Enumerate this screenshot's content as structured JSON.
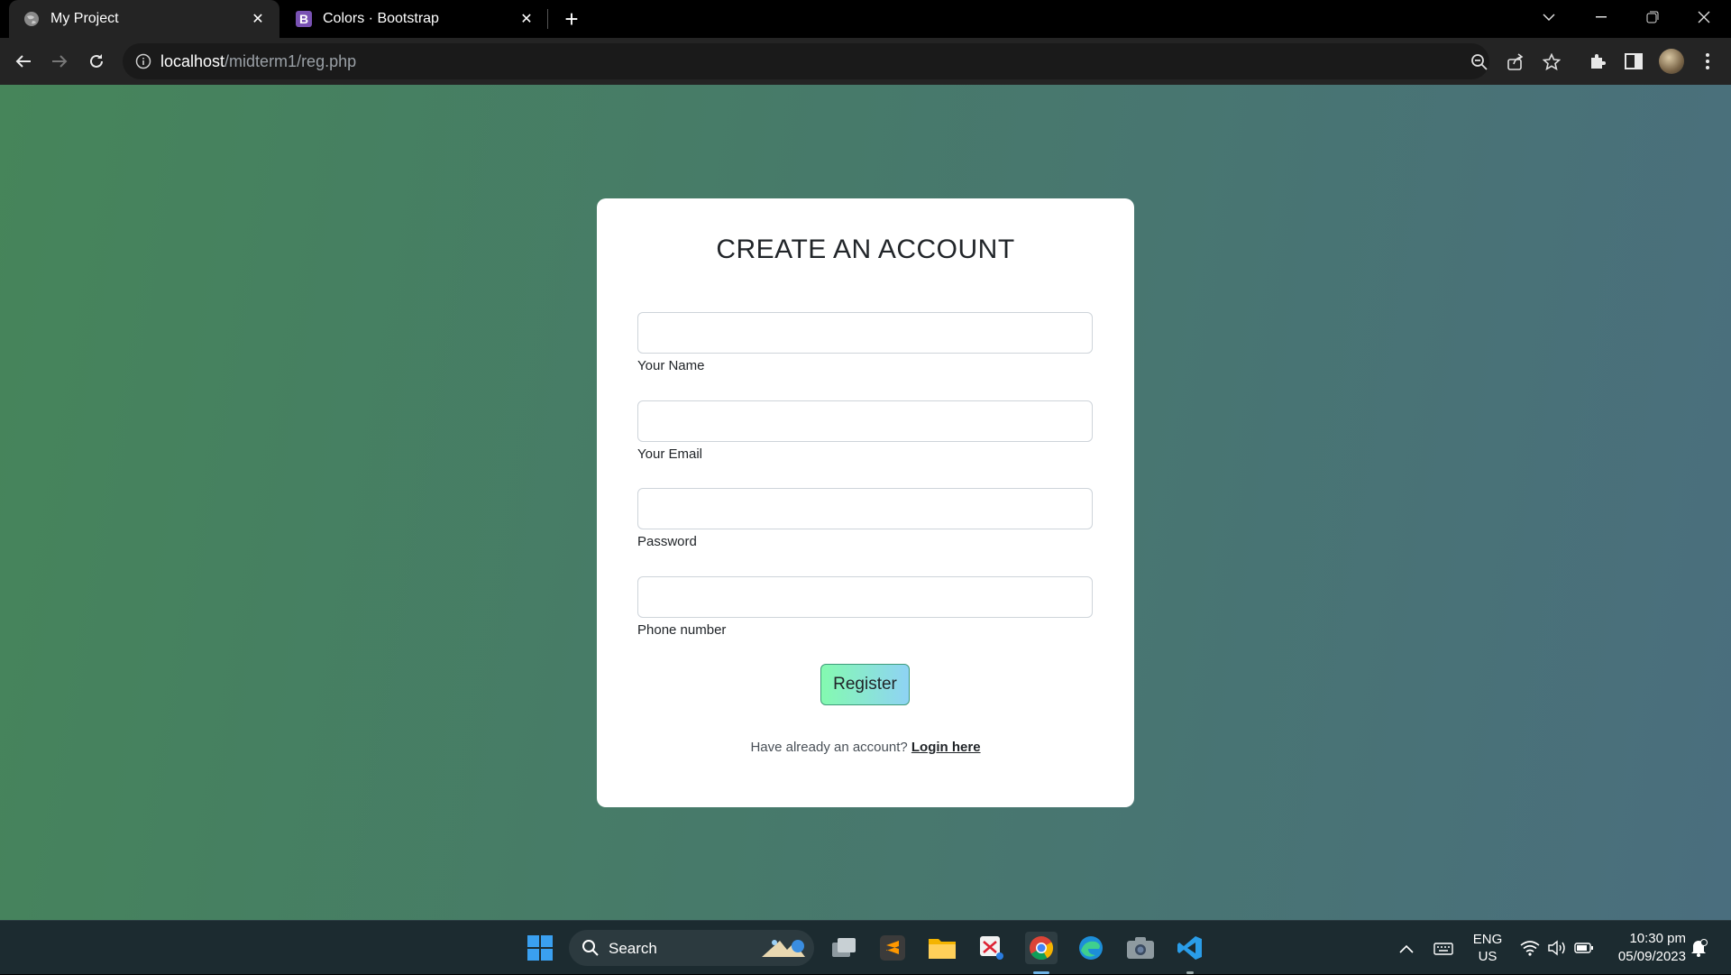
{
  "browser": {
    "tabs": [
      {
        "title": "My Project",
        "active": true
      },
      {
        "title": "Colors · Bootstrap",
        "favicon_letter": "B",
        "active": false
      }
    ],
    "url_host": "localhost",
    "url_path": "/midterm1/reg.php"
  },
  "form": {
    "heading": "CREATE AN ACCOUNT",
    "fields": [
      {
        "label": "Your Name",
        "value": ""
      },
      {
        "label": "Your Email",
        "value": ""
      },
      {
        "label": "Password",
        "value": ""
      },
      {
        "label": "Phone number",
        "value": ""
      }
    ],
    "submit_label": "Register",
    "login_prompt": "Have already an account? ",
    "login_link": "Login here"
  },
  "taskbar": {
    "search_label": "Search",
    "lang_top": "ENG",
    "lang_bottom": "US",
    "time": "10:30 pm",
    "date": "05/09/2023"
  },
  "colors": {
    "gradient_start": "#46855a",
    "gradient_end": "#4a6e7e",
    "button_start": "#84fab0",
    "button_end": "#8fd3f4"
  }
}
